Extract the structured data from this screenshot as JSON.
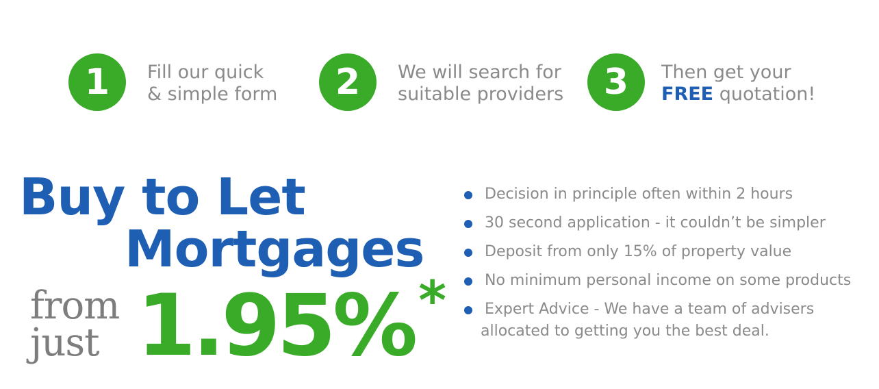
{
  "steps": [
    {
      "number": "1",
      "line1": "Fill our quick",
      "line2": "& simple form"
    },
    {
      "number": "2",
      "line1": "We will search for",
      "line2": "suitable providers"
    },
    {
      "number": "3",
      "line1": "Then get your",
      "line2_highlight": "FREE",
      "line2_rest": " quotation!"
    }
  ],
  "headline": {
    "line1": "Buy to Let",
    "line2": "Mortgages"
  },
  "offer": {
    "from": "from",
    "just": "just",
    "rate": "1.95%",
    "asterisk": "*"
  },
  "features": [
    "Decision in principle often within 2 hours",
    "30 second application - it couldn’t be simpler",
    "Deposit from only 15% of property value",
    "No minimum personal income on some products",
    "Expert Advice - We have a team of advisers allocated to getting you the best deal."
  ],
  "colors": {
    "green": "#3aab28",
    "blue": "#1e5fb4",
    "grey": "#8a8a8a"
  }
}
